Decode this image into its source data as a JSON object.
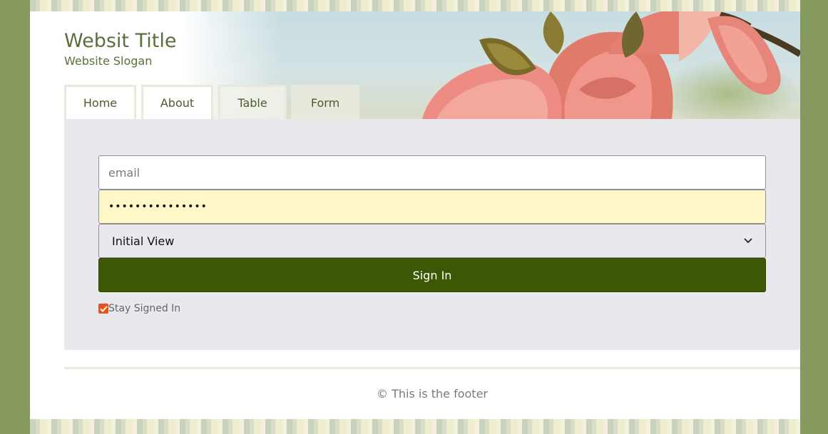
{
  "site": {
    "title": "Websit Title",
    "slogan": "Website Slogan"
  },
  "nav": {
    "tabs": [
      {
        "label": "Home"
      },
      {
        "label": "About"
      },
      {
        "label": "Table"
      },
      {
        "label": "Form",
        "active": true
      }
    ]
  },
  "form": {
    "email_placeholder": "email",
    "email_value": "",
    "password_value": "•••••••••••••••",
    "view_select": {
      "selected": "Initial View"
    },
    "signin_label": "Sign In",
    "stay_signed_in": {
      "label": "Stay Signed In",
      "checked": true
    }
  },
  "footer": {
    "text": "© This is the footer"
  },
  "colors": {
    "page_background": "#86995e",
    "accent_button": "#3d5804",
    "checkbox": "#e2531d",
    "password_autofill": "#fff7c8",
    "content_panel": "#e9e9ed"
  },
  "icons": {
    "select_arrow": "chevron-down-icon",
    "checkbox_mark": "check-icon"
  }
}
